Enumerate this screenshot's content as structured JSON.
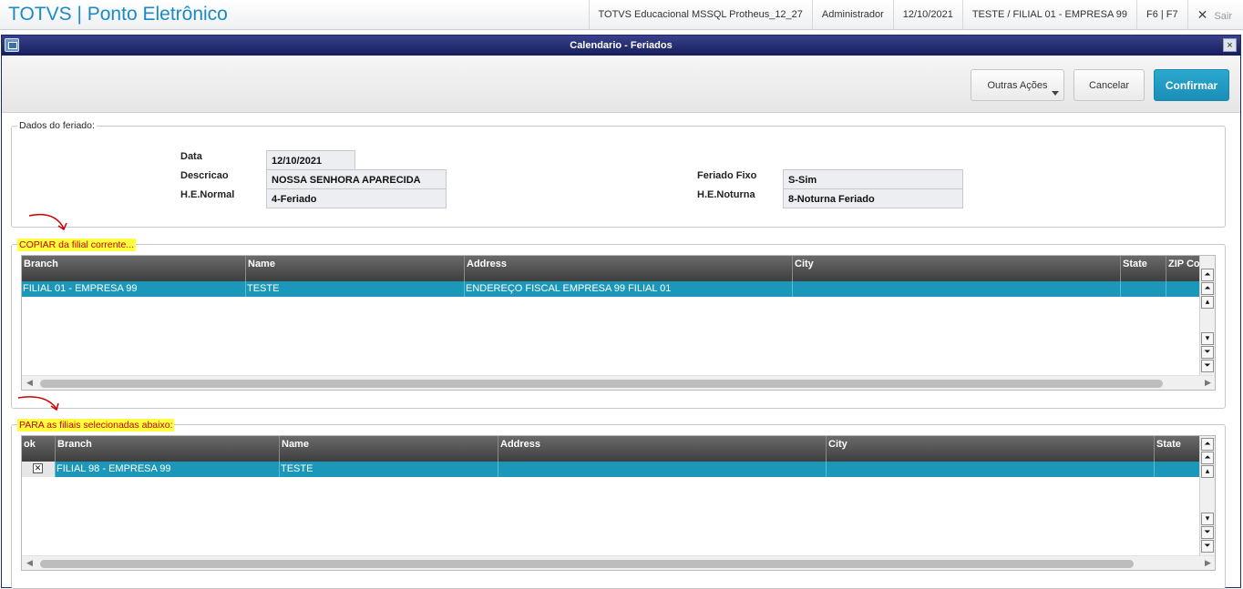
{
  "app": {
    "title": "TOTVS | Ponto Eletrônico",
    "environment": "TOTVS Educacional MSSQL Protheus_12_27",
    "user": "Administrador",
    "date": "12/10/2021",
    "company": "TESTE / FILIAL 01 - EMPRESA 99",
    "shortcuts": "F6 | F7",
    "exit_label": "Sair"
  },
  "window": {
    "title": "Calendario - Feriados",
    "close_glyph": "×"
  },
  "toolbar": {
    "more_actions_label": "Outras Ações",
    "cancel_label": "Cancelar",
    "confirm_label": "Confirmar"
  },
  "holiday": {
    "legend": "Dados do feriado:",
    "date_label": "Data",
    "date_value": "12/10/2021",
    "description_label": "Descricao",
    "description_value": "NOSSA SENHORA APARECIDA",
    "he_normal_label": "H.E.Normal",
    "he_normal_value": "4-Feriado",
    "fixed_label": "Feriado Fixo",
    "fixed_value": "S-Sim",
    "he_night_label": "H.E.Noturna",
    "he_night_value": "8-Noturna Feriado"
  },
  "source_grid": {
    "legend": "COPIAR da filial corrente...",
    "columns": [
      "Branch",
      "Name",
      "Address",
      "City",
      "State",
      "ZIP Code"
    ],
    "rows": [
      [
        "FILIAL 01 - EMPRESA 99",
        "TESTE",
        "ENDEREÇO FISCAL EMPRESA 99 FILIAL 01",
        "",
        "",
        ""
      ]
    ]
  },
  "target_grid": {
    "legend": "PARA as filiais selecionadas abaixo:",
    "columns": [
      "ok",
      "Branch",
      "Name",
      "Address",
      "City",
      "State"
    ],
    "rows": [
      {
        "checked": true,
        "check_glyph": "✕",
        "cells": [
          "FILIAL 98 - EMPRESA 99",
          "TESTE",
          "",
          "",
          ""
        ]
      }
    ]
  },
  "colors": {
    "accent": "#1b8ac4",
    "confirm": "#1f98c2",
    "selected_row": "#1b97ba",
    "window_title": "#1c2468",
    "highlight": "#ffff3d",
    "annotation": "#d00000"
  }
}
